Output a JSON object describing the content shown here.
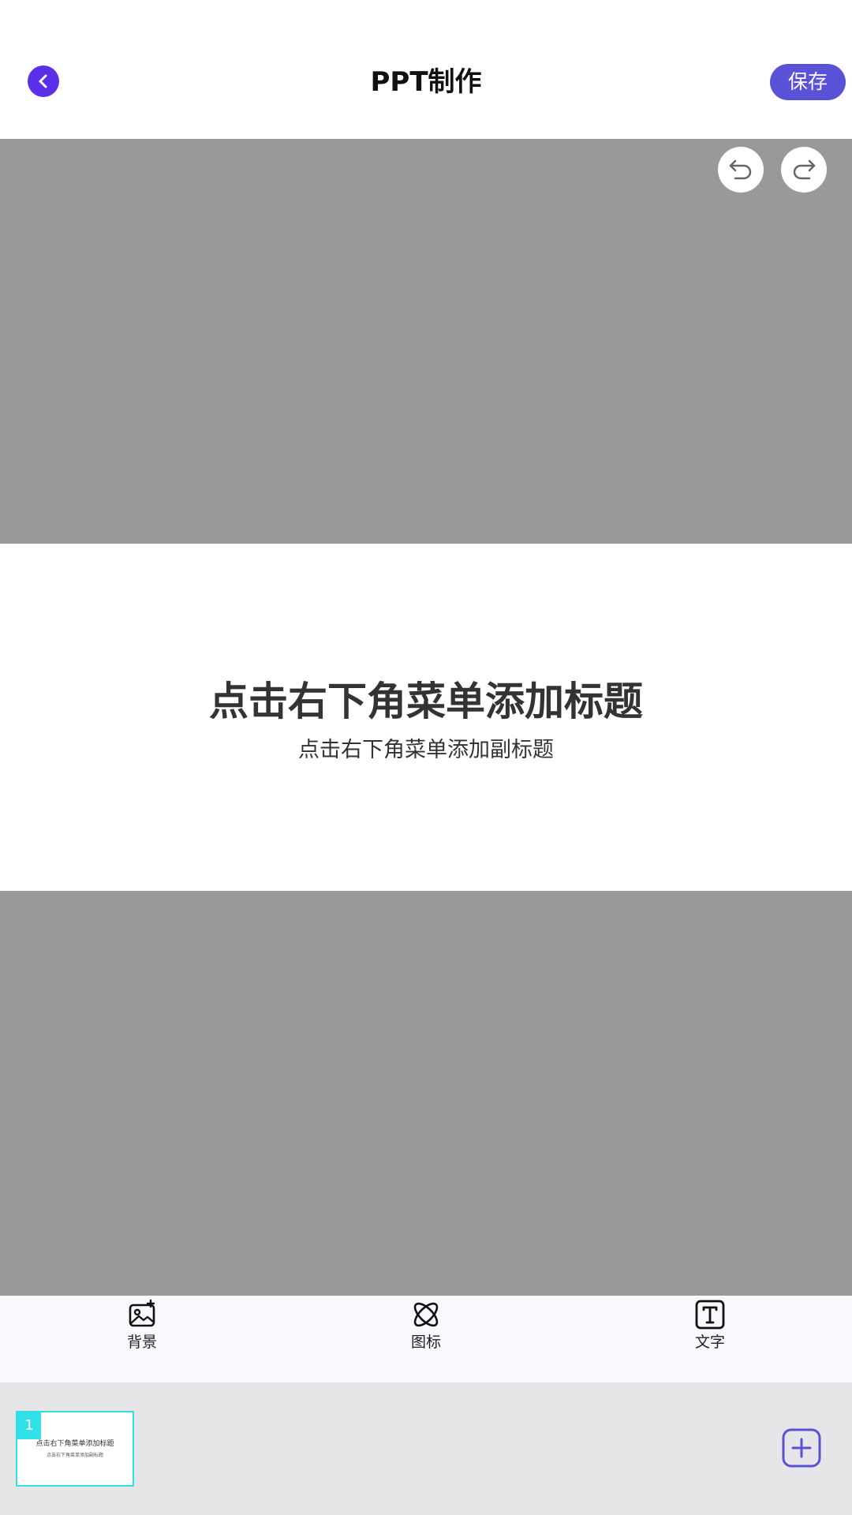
{
  "header": {
    "back_icon": "chevron-left-icon",
    "title": "PPT制作",
    "save_label": "保存",
    "accent": "#5a52d6",
    "back_color": "#5b2ee8"
  },
  "canvas": {
    "background": "#999999",
    "undo_icon": "undo-icon",
    "redo_icon": "redo-icon",
    "slide": {
      "title": "点击右下角菜单添加标题",
      "subtitle": "点击右下角菜单添加副标题"
    },
    "fab": {
      "icon": "menu-icon",
      "color": "#f33d7c"
    }
  },
  "toolbar": {
    "items": [
      {
        "label": "背景",
        "icon": "image-icon"
      },
      {
        "label": "图标",
        "icon": "atom-icon"
      },
      {
        "label": "文字",
        "icon": "text-icon"
      }
    ]
  },
  "slides": {
    "items": [
      {
        "number": "1",
        "title": "点击右下角菜单添加标题",
        "subtitle": "点击右下角菜单添加副标题",
        "selected": true
      }
    ],
    "add_icon": "plus-icon",
    "accent": "#2fe0e6"
  }
}
